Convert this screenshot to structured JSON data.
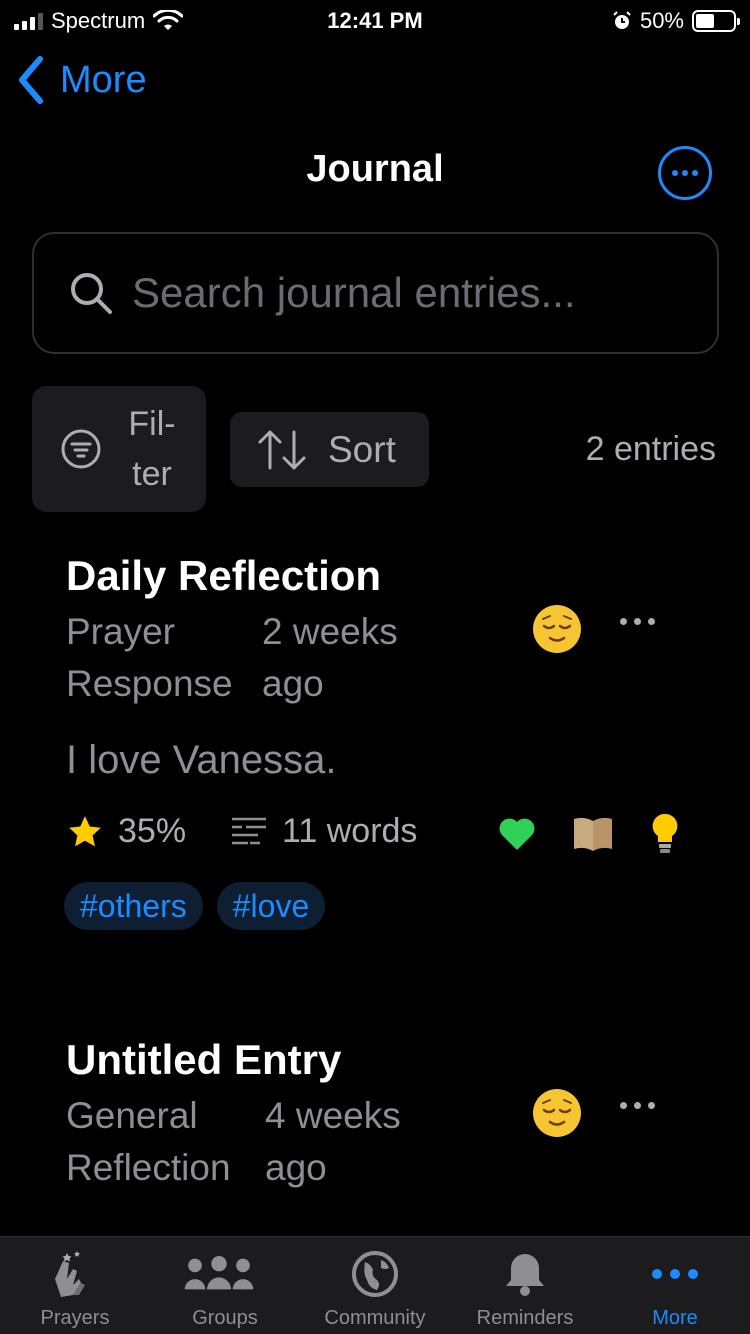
{
  "status": {
    "carrier": "Spectrum",
    "time": "12:41 PM",
    "battery": "50%",
    "battery_level": 0.5
  },
  "nav": {
    "back_label": "More",
    "title": "Journal"
  },
  "search": {
    "placeholder": "Search journal entries..."
  },
  "controls": {
    "filter_line1": "Fil-",
    "filter_line2": "ter",
    "sort_label": "Sort",
    "entries_count": "2 entries"
  },
  "entries": [
    {
      "title": "Daily Reflection",
      "category_line1": "Prayer",
      "category_line2": "Response",
      "date_line1": "2 weeks",
      "date_line2": "ago",
      "mood": "relieved-face",
      "body": "I love Vanessa.",
      "rating": "35%",
      "word_count": "11 words",
      "tags": [
        "#others",
        "#love"
      ]
    },
    {
      "title": "Untitled Entry",
      "category_line1": "General",
      "category_line2": "Reflection",
      "date_line1": "4 weeks",
      "date_line2": "ago",
      "mood": "relieved-face"
    }
  ],
  "tabs": [
    {
      "label": "Prayers",
      "icon": "praying-hands-icon"
    },
    {
      "label": "Groups",
      "icon": "people-icon"
    },
    {
      "label": "Community",
      "icon": "globe-icon"
    },
    {
      "label": "Reminders",
      "icon": "bell-icon"
    },
    {
      "label": "More",
      "icon": "ellipsis-icon",
      "active": true
    }
  ],
  "colors": {
    "accent": "#1a8cff",
    "background": "#000000",
    "card": "#1c1c1e",
    "secondary_text": "#8e8e93",
    "star": "#ffcc00",
    "heart": "#30d158"
  }
}
